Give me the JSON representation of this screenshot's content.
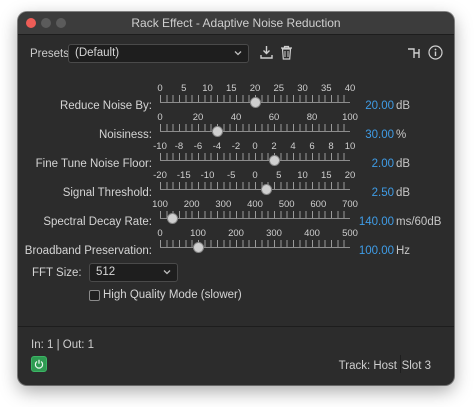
{
  "window": {
    "title": "Rack Effect - Adaptive Noise Reduction"
  },
  "presets": {
    "label": "Presets:",
    "value": "(Default)"
  },
  "sliders": [
    {
      "label": "Reduce Noise By:",
      "value": "20.00",
      "unit": "dB",
      "ticks": [
        "0",
        "5",
        "10",
        "15",
        "20",
        "25",
        "30",
        "35",
        "40"
      ],
      "min": 0,
      "max": 40,
      "current": 20
    },
    {
      "label": "Noisiness:",
      "value": "30.00",
      "unit": "%",
      "ticks": [
        "0",
        "20",
        "40",
        "60",
        "80",
        "100"
      ],
      "min": 0,
      "max": 100,
      "current": 30
    },
    {
      "label": "Fine Tune Noise Floor:",
      "value": "2.00",
      "unit": "dB",
      "ticks": [
        "-10",
        "-8",
        "-6",
        "-4",
        "-2",
        "0",
        "2",
        "4",
        "6",
        "8",
        "10"
      ],
      "min": -10,
      "max": 10,
      "current": 2
    },
    {
      "label": "Signal Threshold:",
      "value": "2.50",
      "unit": "dB",
      "ticks": [
        "-20",
        "-15",
        "-10",
        "-5",
        "0",
        "5",
        "10",
        "15",
        "20"
      ],
      "min": -20,
      "max": 20,
      "current": 2.5
    },
    {
      "label": "Spectral Decay Rate:",
      "value": "140.00",
      "unit": "ms/60dB",
      "ticks": [
        "100",
        "200",
        "300",
        "400",
        "500",
        "600",
        "700"
      ],
      "min": 100,
      "max": 700,
      "current": 140
    },
    {
      "label": "Broadband Preservation:",
      "value": "100.00",
      "unit": "Hz",
      "ticks": [
        "0",
        "100",
        "200",
        "300",
        "400",
        "500"
      ],
      "min": 0,
      "max": 500,
      "current": 100
    }
  ],
  "fft": {
    "label": "FFT Size:",
    "value": "512"
  },
  "hq_mode": {
    "label": "High Quality Mode (slower)",
    "checked": false
  },
  "footer": {
    "io": "In: 1 | Out: 1",
    "track": "Track: Host",
    "slot": "Slot 3"
  },
  "icons": {
    "save_preset": "download-icon",
    "delete_preset": "trash-icon",
    "routing": "routing-icon",
    "info": "info-icon",
    "power": "power-icon"
  },
  "colors": {
    "value_blue": "#3f9ce6",
    "power_green": "#2f9a52",
    "close_red": "#ee5d57"
  }
}
